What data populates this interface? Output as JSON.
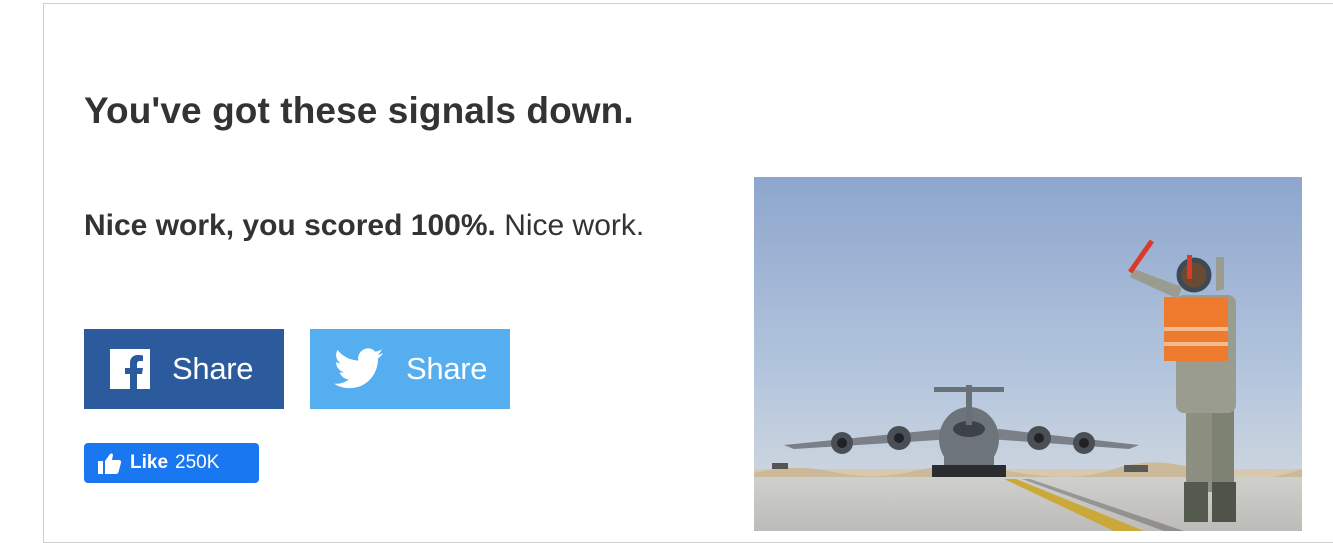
{
  "result": {
    "headline": "You've got these signals down.",
    "score_text": "Nice work, you scored 100%.",
    "comment": "Nice work."
  },
  "share": {
    "facebook_label": "Share",
    "twitter_label": "Share"
  },
  "like": {
    "label": "Like",
    "count": "250K"
  },
  "icons": {
    "facebook": "facebook-logo-icon",
    "twitter": "twitter-bird-icon",
    "like": "thumbs-up-icon"
  },
  "colors": {
    "facebook": "#2b5b9c",
    "twitter": "#55aef0",
    "like": "#1a77f2",
    "text": "#333333"
  }
}
